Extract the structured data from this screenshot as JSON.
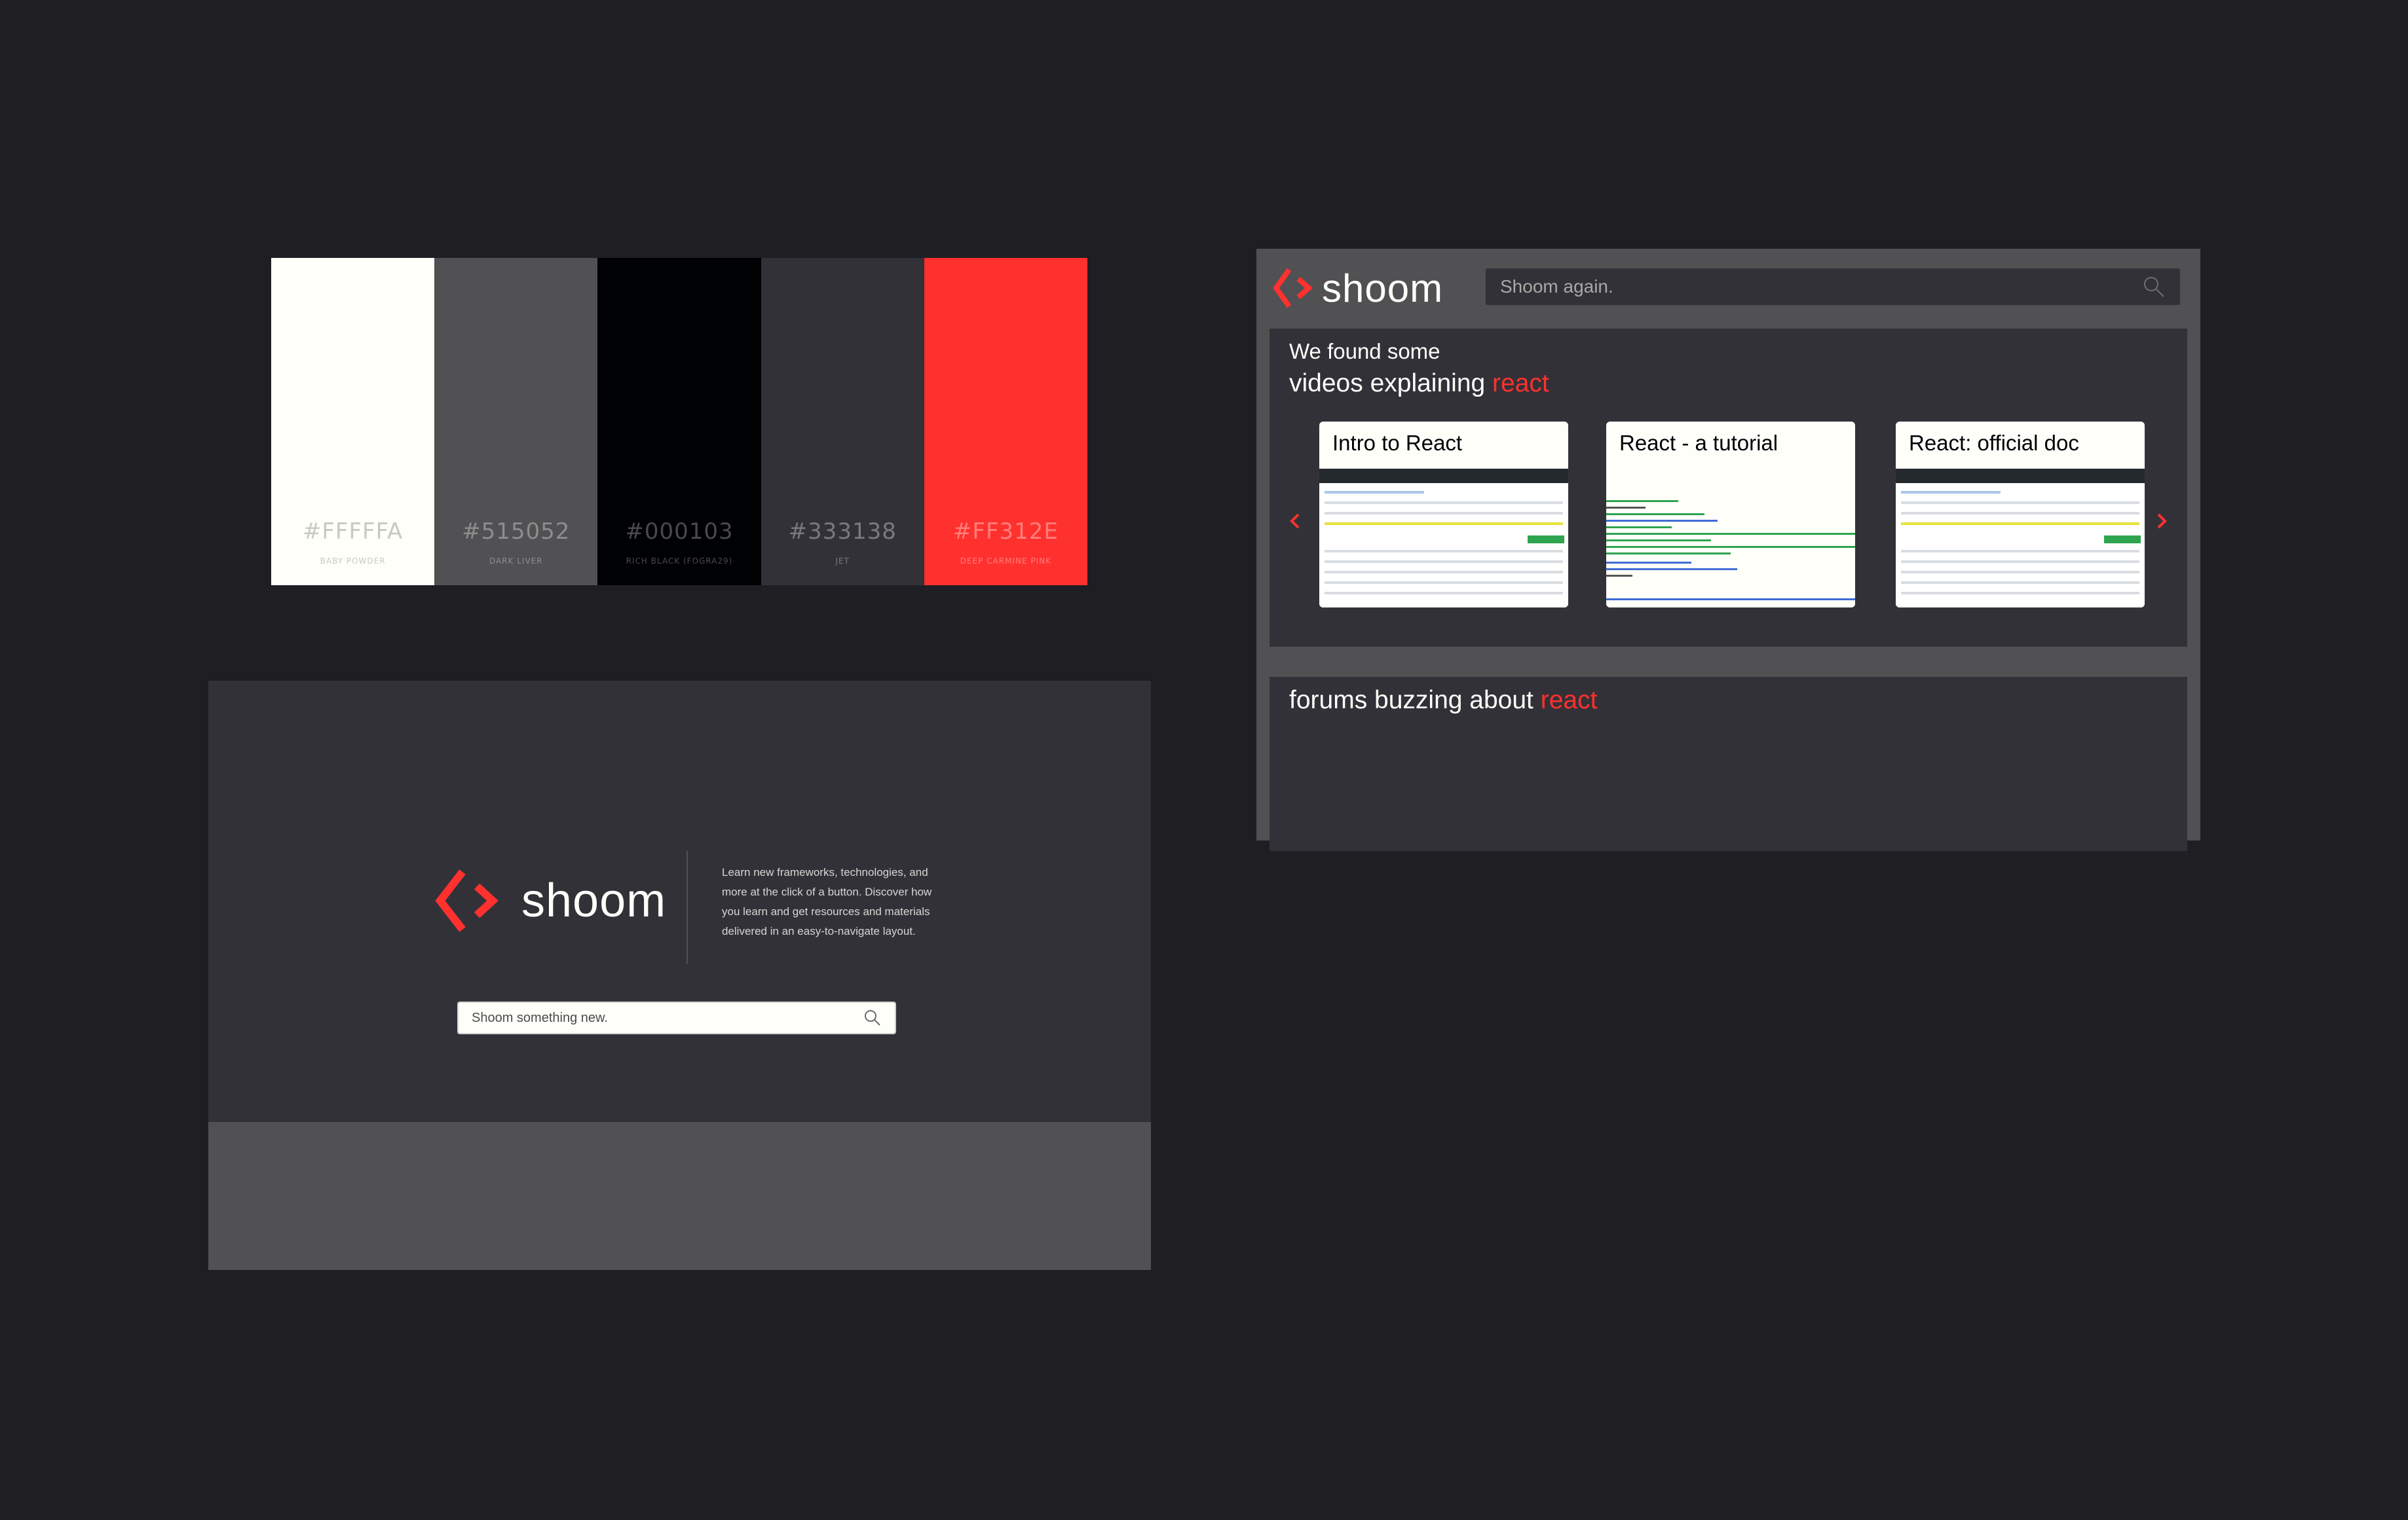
{
  "palette": [
    {
      "hex": "#FFFFFA",
      "name": "BABY POWDER",
      "color": "#fffffa",
      "hex_color": "#c9c8c4",
      "name_color": "#c9c8c4"
    },
    {
      "hex": "#515052",
      "name": "DARK LIVER",
      "color": "#515052",
      "hex_color": "#8e8d8e",
      "name_color": "#8e8d8e"
    },
    {
      "hex": "#000103",
      "name": "RICH BLACK (FOGRA29)",
      "color": "#000103",
      "hex_color": "#4a4a4d",
      "name_color": "#4a4a4d"
    },
    {
      "hex": "#333138",
      "name": "JET",
      "color": "#333138",
      "hex_color": "#7a7980",
      "name_color": "#7a7980"
    },
    {
      "hex": "#FF312E",
      "name": "DEEP CARMINE PINK",
      "color": "#ff312e",
      "hex_color": "#ff7e7c",
      "name_color": "#ff7e7c"
    }
  ],
  "landing": {
    "brand": "shoom",
    "description": "Learn new frameworks, technologies, and more at the click of a button. Discover how you learn and get resources and materials delivered in an easy-to-navigate layout.",
    "search_placeholder": "Shoom something new.",
    "icons": {
      "logo": "code-brackets-icon",
      "search": "search-icon"
    }
  },
  "results": {
    "brand": "shoom",
    "search_placeholder": "Shoom again.",
    "videos": {
      "line1": "We found some",
      "line2_prefix": "videos explaining ",
      "term": "react",
      "cards": [
        {
          "title": "Intro to React",
          "thumb": "github"
        },
        {
          "title": "React - a tutorial",
          "thumb": "code"
        },
        {
          "title": "React: official doc",
          "thumb": "github"
        }
      ],
      "icons": {
        "prev": "chevron-left-icon",
        "next": "chevron-right-icon"
      }
    },
    "forums": {
      "line_prefix": "forums buzzing about ",
      "term": "react"
    }
  },
  "colors": {
    "accent": "#ff312e",
    "jet": "#333138",
    "dark_liver": "#515052",
    "baby_powder": "#fffffa"
  }
}
